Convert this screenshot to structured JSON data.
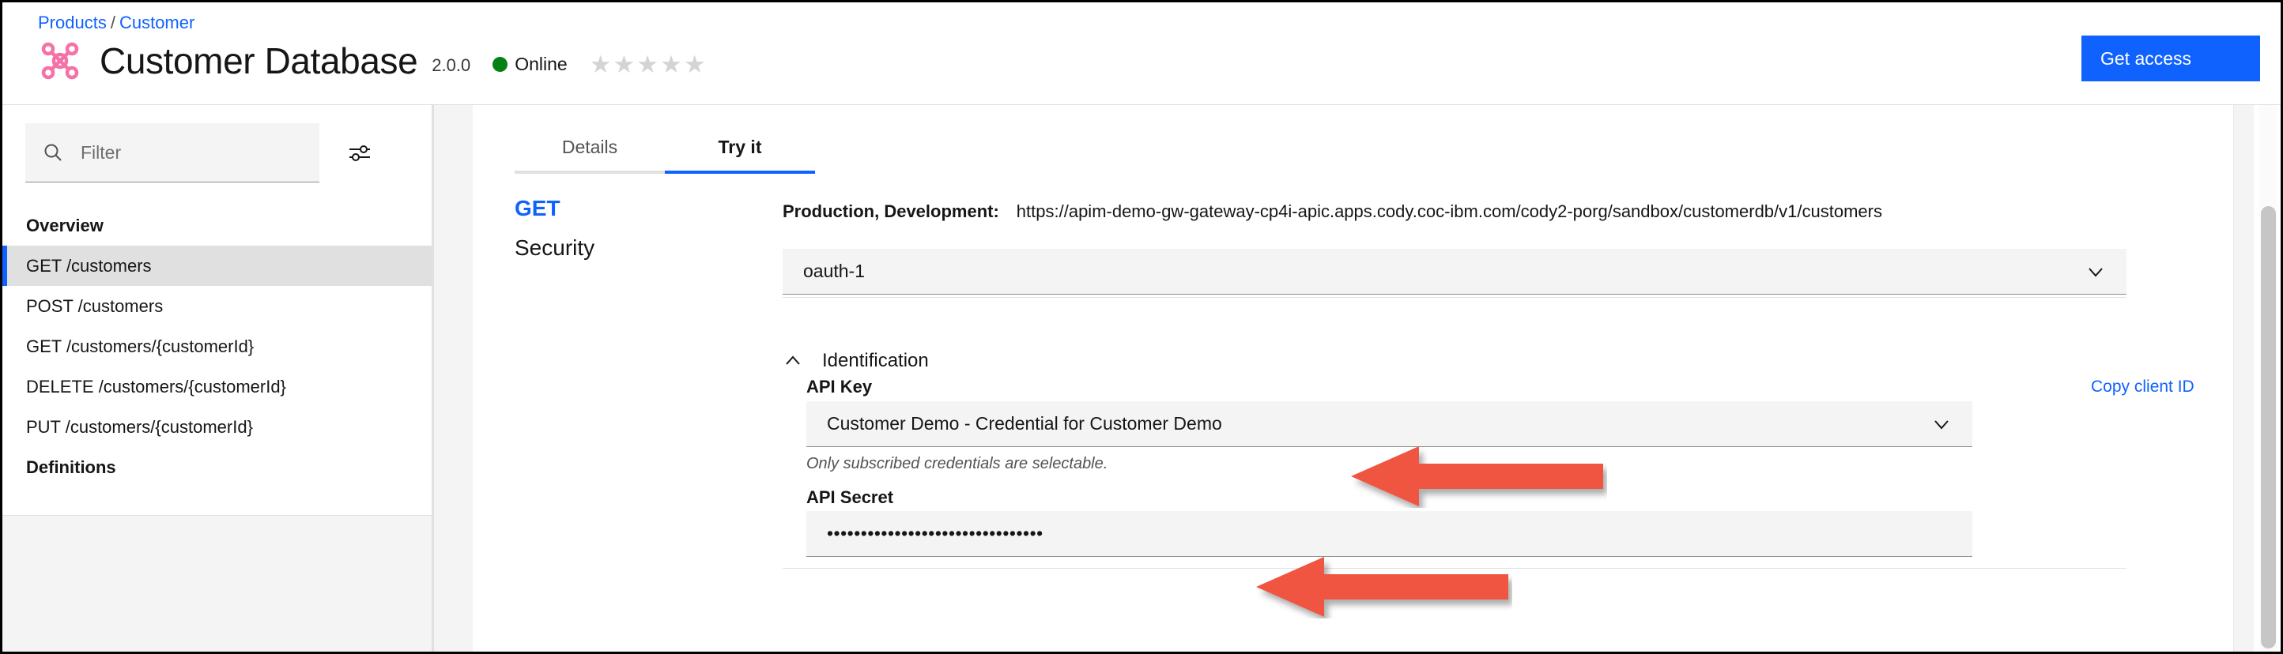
{
  "colors": {
    "accent_blue": "#0f62fe",
    "brand_pink": "#f472a8",
    "status_green": "#068012",
    "field_gray": "#f4f4f4",
    "arrow_red": "#ef5440"
  },
  "header": {
    "breadcrumb": {
      "items": [
        "Products",
        "Customer"
      ],
      "separator": "/"
    },
    "logo_icon": "network-hub-icon",
    "title": "Customer Database",
    "version": "2.0.0",
    "status": {
      "label": "Online",
      "dot_icon": "status-dot-online"
    },
    "rating": {
      "stars": [
        "★",
        "★",
        "★",
        "★",
        "★"
      ],
      "filled": 0,
      "total": 5
    },
    "get_access_label": "Get access"
  },
  "sidebar": {
    "filter": {
      "icon": "search-icon",
      "placeholder": "Filter",
      "value": ""
    },
    "settings_icon": "sliders-settings-icon",
    "items": [
      {
        "label": "Overview",
        "type": "heading",
        "selected": false
      },
      {
        "label": "GET /customers",
        "type": "operation",
        "selected": true
      },
      {
        "label": "POST /customers",
        "type": "operation",
        "selected": false
      },
      {
        "label": "GET /customers/{customerId}",
        "type": "operation",
        "selected": false
      },
      {
        "label": "DELETE /customers/{customerId}",
        "type": "operation",
        "selected": false
      },
      {
        "label": "PUT /customers/{customerId}",
        "type": "operation",
        "selected": false
      },
      {
        "label": "Definitions",
        "type": "heading",
        "selected": false
      }
    ]
  },
  "main": {
    "tabs": [
      {
        "label": "Details",
        "active": false
      },
      {
        "label": "Try it",
        "active": true
      }
    ],
    "nav": {
      "method": "GET",
      "security": "Security"
    },
    "endpoint": {
      "env_label": "Production, Development:",
      "url": "https://apim-demo-gw-gateway-cp4i-apic.apps.cody.coc-ibm.com/cody2-porg/sandbox/customerdb/v1/customers"
    },
    "oauth_select": {
      "value": "oauth-1",
      "chevron_icon": "chevron-down-icon"
    },
    "identification": {
      "title": "Identification",
      "chevron_icon": "chevron-up-icon",
      "api_key": {
        "label": "API Key",
        "copy_link": "Copy client ID",
        "value": "Customer Demo - Credential for Customer Demo",
        "chevron_icon": "chevron-down-icon",
        "helper_text": "Only subscribed credentials are selectable."
      },
      "api_secret": {
        "label": "API Secret",
        "masked_value": "••••••••••••••••••••••••••••••••"
      }
    }
  },
  "annotations": [
    {
      "name": "arrow-pointing-to-api-key-select",
      "direction": "left"
    },
    {
      "name": "arrow-pointing-to-api-secret-field",
      "direction": "left"
    }
  ]
}
